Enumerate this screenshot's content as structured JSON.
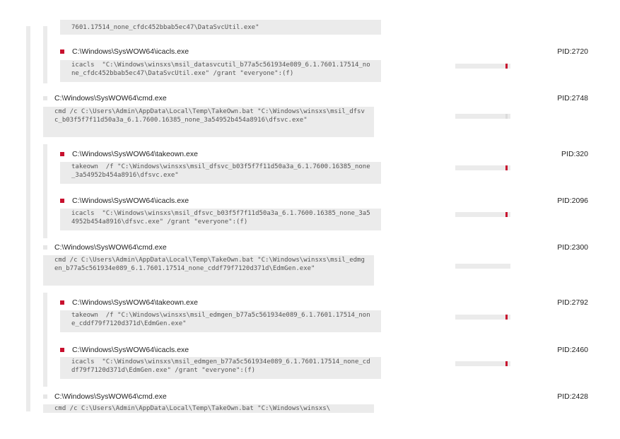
{
  "colors": {
    "accent": "#c8102e",
    "panel": "#ebebeb"
  },
  "top_fragment": {
    "cmd": "7601.17514_none_cfdc452bbab5ec47\\DataSvcUtil.exe\""
  },
  "rows": [
    {
      "path": "C:\\Windows\\SysWOW64\\icacls.exe",
      "pid": "PID:2720",
      "cmd": "icacls  \"C:\\Windows\\winsxs\\msil_datasvcutil_b77a5c561934e089_6.1.7601.17514_none_cfdc452bbab5ec47\\DataSvcUtil.exe\" /grant \"everyone\":(f)"
    },
    {
      "path": "C:\\Windows\\SysWOW64\\cmd.exe",
      "pid": "PID:2748",
      "cmd": "cmd /c C:\\Users\\Admin\\AppData\\Local\\Temp\\TakeOwn.bat \"C:\\Windows\\winsxs\\msil_dfsvc_b03f5f7f11d50a3a_6.1.7600.16385_none_3a54952b454a8916\\dfsvc.exe\""
    },
    {
      "path": "C:\\Windows\\SysWOW64\\takeown.exe",
      "pid": "PID:320",
      "cmd": "takeown  /f \"C:\\Windows\\winsxs\\msil_dfsvc_b03f5f7f11d50a3a_6.1.7600.16385_none_3a54952b454a8916\\dfsvc.exe\""
    },
    {
      "path": "C:\\Windows\\SysWOW64\\icacls.exe",
      "pid": "PID:2096",
      "cmd": "icacls  \"C:\\Windows\\winsxs\\msil_dfsvc_b03f5f7f11d50a3a_6.1.7600.16385_none_3a54952b454a8916\\dfsvc.exe\" /grant \"everyone\":(f)"
    },
    {
      "path": "C:\\Windows\\SysWOW64\\cmd.exe",
      "pid": "PID:2300",
      "cmd": "cmd /c C:\\Users\\Admin\\AppData\\Local\\Temp\\TakeOwn.bat \"C:\\Windows\\winsxs\\msil_edmgen_b77a5c561934e089_6.1.7601.17514_none_cddf79f7120d371d\\EdmGen.exe\""
    },
    {
      "path": "C:\\Windows\\SysWOW64\\takeown.exe",
      "pid": "PID:2792",
      "cmd": "takeown  /f \"C:\\Windows\\winsxs\\msil_edmgen_b77a5c561934e089_6.1.7601.17514_none_cddf79f7120d371d\\EdmGen.exe\""
    },
    {
      "path": "C:\\Windows\\SysWOW64\\icacls.exe",
      "pid": "PID:2460",
      "cmd": "icacls  \"C:\\Windows\\winsxs\\msil_edmgen_b77a5c561934e089_6.1.7601.17514_none_cddf79f7120d371d\\EdmGen.exe\" /grant \"everyone\":(f)"
    },
    {
      "path": "C:\\Windows\\SysWOW64\\cmd.exe",
      "pid": "PID:2428",
      "cmd": "cmd /c C:\\Users\\Admin\\AppData\\Local\\Temp\\TakeOwn.bat \"C:\\Windows\\winsxs\\"
    }
  ]
}
